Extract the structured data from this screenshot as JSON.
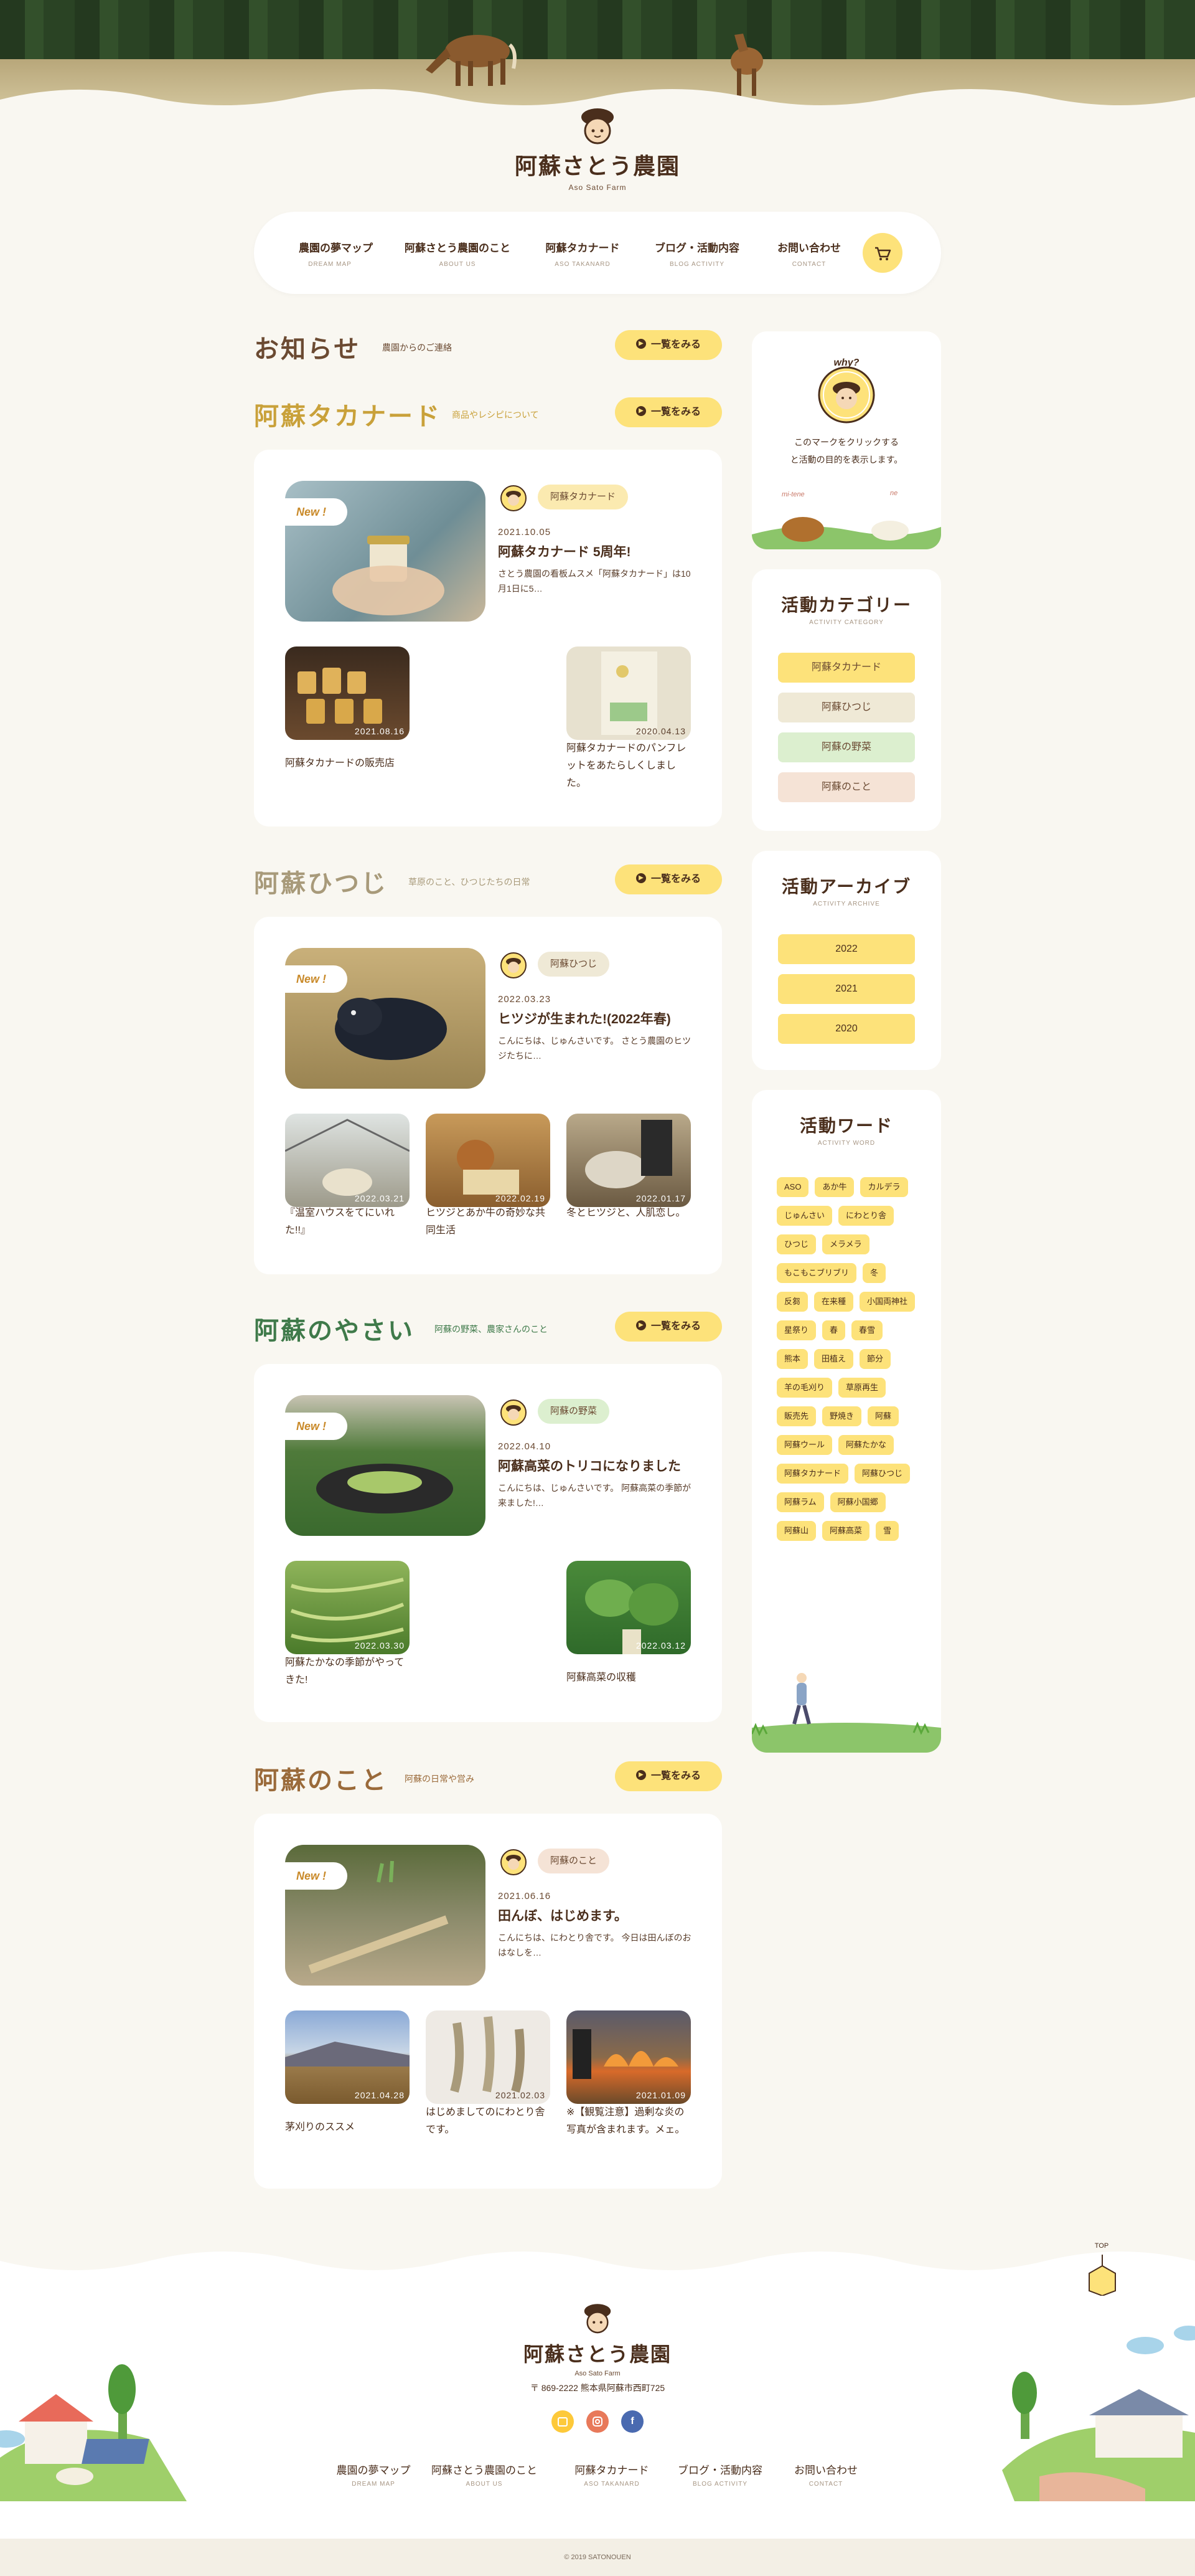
{
  "site": {
    "name": "阿蘇さとう農園",
    "sub": "Aso Sato Farm"
  },
  "nav": [
    {
      "jp": "農園の夢マップ",
      "en": "DREAM MAP"
    },
    {
      "jp": "阿蘇さとう農園のこと",
      "en": "ABOUT US"
    },
    {
      "jp": "阿蘇タカナード",
      "en": "ASO TAKANARD"
    },
    {
      "jp": "ブログ・活動内容",
      "en": "BLOG ACTIVITY"
    },
    {
      "jp": "お問い合わせ",
      "en": "CONTACT"
    }
  ],
  "more_label": "一覧をみる",
  "news": {
    "title": "お知らせ",
    "sub": "農園からのご連絡"
  },
  "sections": [
    {
      "title": "阿蘇タカナード",
      "sub": "商品やレシピについて",
      "color": "#c9a13a",
      "featured": {
        "new": "New !",
        "category": "阿蘇タカナード",
        "cat_color": "#fbeab0",
        "date": "2021.10.05",
        "title": "阿蘇タカナード 5周年!",
        "excerpt": "さとう農園の看板ムスメ「阿蘇タカナード」は10月1日に5…"
      },
      "posts": [
        {
          "date": "2021.08.16",
          "title": "阿蘇タカナードの販売店"
        },
        {
          "date": "2020.04.13",
          "title": "阿蘇タカナードのパンフレットをあたらしくしました。"
        }
      ]
    },
    {
      "title": "阿蘇ひつじ",
      "sub": "草原のこと、ひつじたちの日常",
      "color": "#a89a7a",
      "featured": {
        "new": "New !",
        "category": "阿蘇ひつじ",
        "cat_color": "#efe9d6",
        "date": "2022.03.23",
        "title": "ヒツジが生まれた!(2022年春)",
        "excerpt": "こんにちは、じゅんさいです。 さとう農園のヒツジたちに…"
      },
      "posts": [
        {
          "date": "2022.03.21",
          "title": "『温室ハウスをてにいれた!!』"
        },
        {
          "date": "2022.02.19",
          "title": "ヒツジとあか牛の奇妙な共同生活"
        },
        {
          "date": "2022.01.17",
          "title": "冬とヒツジと、人肌恋し。"
        }
      ]
    },
    {
      "title": "阿蘇のやさい",
      "sub": "阿蘇の野菜、農家さんのこと",
      "color": "#3f7a4a",
      "featured": {
        "new": "New !",
        "category": "阿蘇の野菜",
        "cat_color": "#dcefcf",
        "date": "2022.04.10",
        "title": "阿蘇高菜のトリコになりました",
        "excerpt": "こんにちは、じゅんさいです。 阿蘇高菜の季節が来ました!…"
      },
      "posts": [
        {
          "date": "2022.03.30",
          "title": "阿蘇たかなの季節がやってきた!"
        },
        {
          "date": "2022.03.12",
          "title": "阿蘇高菜の収穫"
        }
      ]
    },
    {
      "title": "阿蘇のこと",
      "sub": "阿蘇の日常や営み",
      "color": "#9a6a3a",
      "featured": {
        "new": "New !",
        "category": "阿蘇のこと",
        "cat_color": "#f5e3d6",
        "date": "2021.06.16",
        "title": "田んぼ、はじめます。",
        "excerpt": "こんにちは、にわとり舎です。 今日は田んぼのおはなしを…"
      },
      "posts": [
        {
          "date": "2021.04.28",
          "title": "茅刈りのススメ"
        },
        {
          "date": "2021.02.03",
          "title": "はじめましてのにわとり舎です。"
        },
        {
          "date": "2021.01.09",
          "title": "※【観覧注意】過剰な炎の写真が含まれます。メェ。"
        }
      ]
    }
  ],
  "sidebar": {
    "why": {
      "badge": "why?",
      "text1": "このマークをクリックする",
      "text2": "と活動の目的を表示します。",
      "sign1": "mi-tene",
      "sign2": "ne"
    },
    "categories": {
      "title": "活動カテゴリー",
      "en": "ACTIVITY CATEGORY",
      "items": [
        {
          "label": "阿蘇タカナード",
          "color": "#fde27a"
        },
        {
          "label": "阿蘇ひつじ",
          "color": "#efe9d6"
        },
        {
          "label": "阿蘇の野菜",
          "color": "#dcefcf"
        },
        {
          "label": "阿蘇のこと",
          "color": "#f5e3d6"
        }
      ]
    },
    "archive": {
      "title": "活動アーカイブ",
      "en": "ACTIVITY ARCHIVE",
      "items": [
        "2022",
        "2021",
        "2020"
      ]
    },
    "words": {
      "title": "活動ワード",
      "en": "ACTIVITY WORD",
      "items": [
        "ASO",
        "あか牛",
        "カルデラ",
        "じゅんさい",
        "にわとり舎",
        "ひつじ",
        "メラメラ",
        "もこもこブリブリ",
        "冬",
        "反芻",
        "在来種",
        "小国両神社",
        "星祭り",
        "春",
        "春雪",
        "熊本",
        "田植え",
        "節分",
        "羊の毛刈り",
        "草原再生",
        "販売先",
        "野焼き",
        "阿蘇",
        "阿蘇ウール",
        "阿蘇たかな",
        "阿蘇タカナード",
        "阿蘇ひつじ",
        "阿蘇ラム",
        "阿蘇小国郷",
        "阿蘇山",
        "阿蘇高菜",
        "雪"
      ]
    }
  },
  "top_label": "TOP",
  "footer": {
    "address": "〒 869-2222 熊本県阿蘇市西町725",
    "copyright": "© 2019 SATONOUEN"
  }
}
